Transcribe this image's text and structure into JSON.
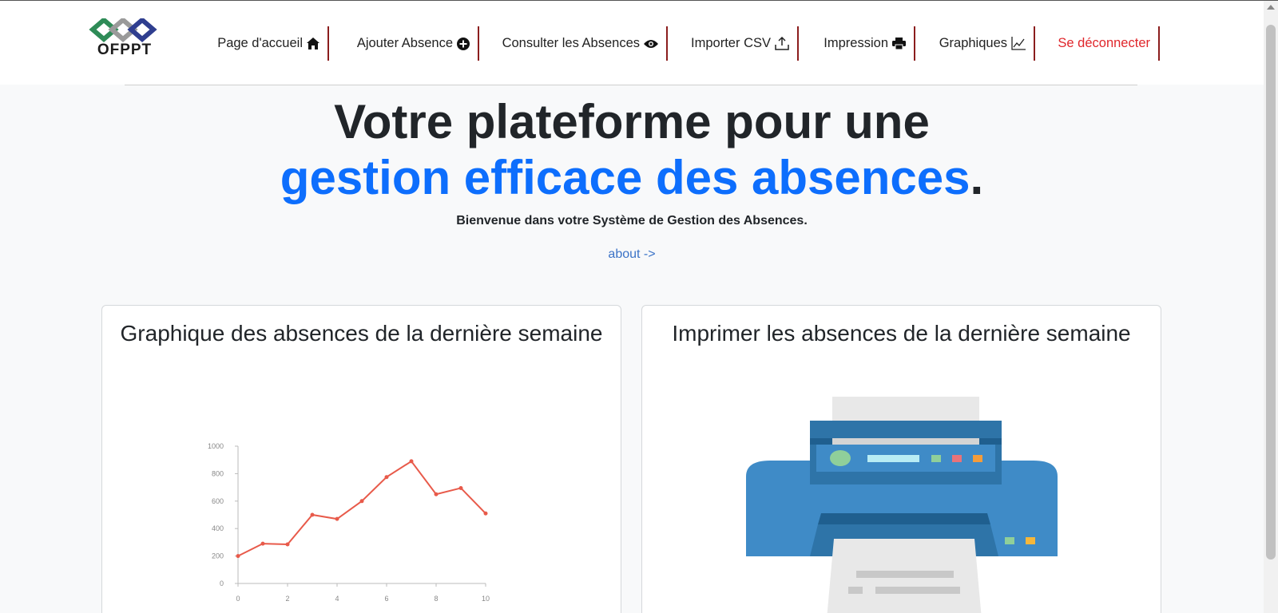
{
  "brand": {
    "logo_text": "OFPPT"
  },
  "nav": {
    "items": [
      {
        "label": "Page d'accueil",
        "icon": "home-icon"
      },
      {
        "label": "Ajouter Absence",
        "icon": "plus-circle-icon"
      },
      {
        "label": "Consulter les Absences",
        "icon": "eye-icon"
      },
      {
        "label": "Importer CSV",
        "icon": "upload-icon"
      },
      {
        "label": "Impression",
        "icon": "printer-icon"
      },
      {
        "label": "Graphiques",
        "icon": "line-chart-icon"
      },
      {
        "label": "Se déconnecter",
        "icon": ""
      }
    ]
  },
  "hero": {
    "title_line1": "Votre plateforme pour une",
    "title_line2": "gestion efficace des absences",
    "title_end": ".",
    "subtitle": "Bienvenue dans votre Système de Gestion des Absences.",
    "about_link": "about ->"
  },
  "cards": {
    "chart_card_title": "Graphique des absences de la dernière semaine",
    "print_card_title": "Imprimer les absences de la dernière semaine"
  },
  "colors": {
    "accent": "#0d6efd",
    "logout": "#e0262b",
    "nav_separator": "#8b1d1d",
    "chart_line": "#e85a4a",
    "printer_blue": "#3f8bc7"
  },
  "chart_data": {
    "type": "line",
    "x": [
      0,
      1,
      2,
      3,
      4,
      5,
      6,
      7,
      8,
      9,
      10
    ],
    "values": [
      200,
      290,
      285,
      500,
      470,
      600,
      775,
      890,
      650,
      695,
      510
    ],
    "xticks": [
      "0",
      "2",
      "4",
      "6",
      "8",
      "10"
    ],
    "yticks": [
      "0",
      "200",
      "400",
      "600",
      "800",
      "1000"
    ],
    "xlim": [
      0,
      10
    ],
    "ylim": [
      0,
      1000
    ],
    "grid": false
  }
}
